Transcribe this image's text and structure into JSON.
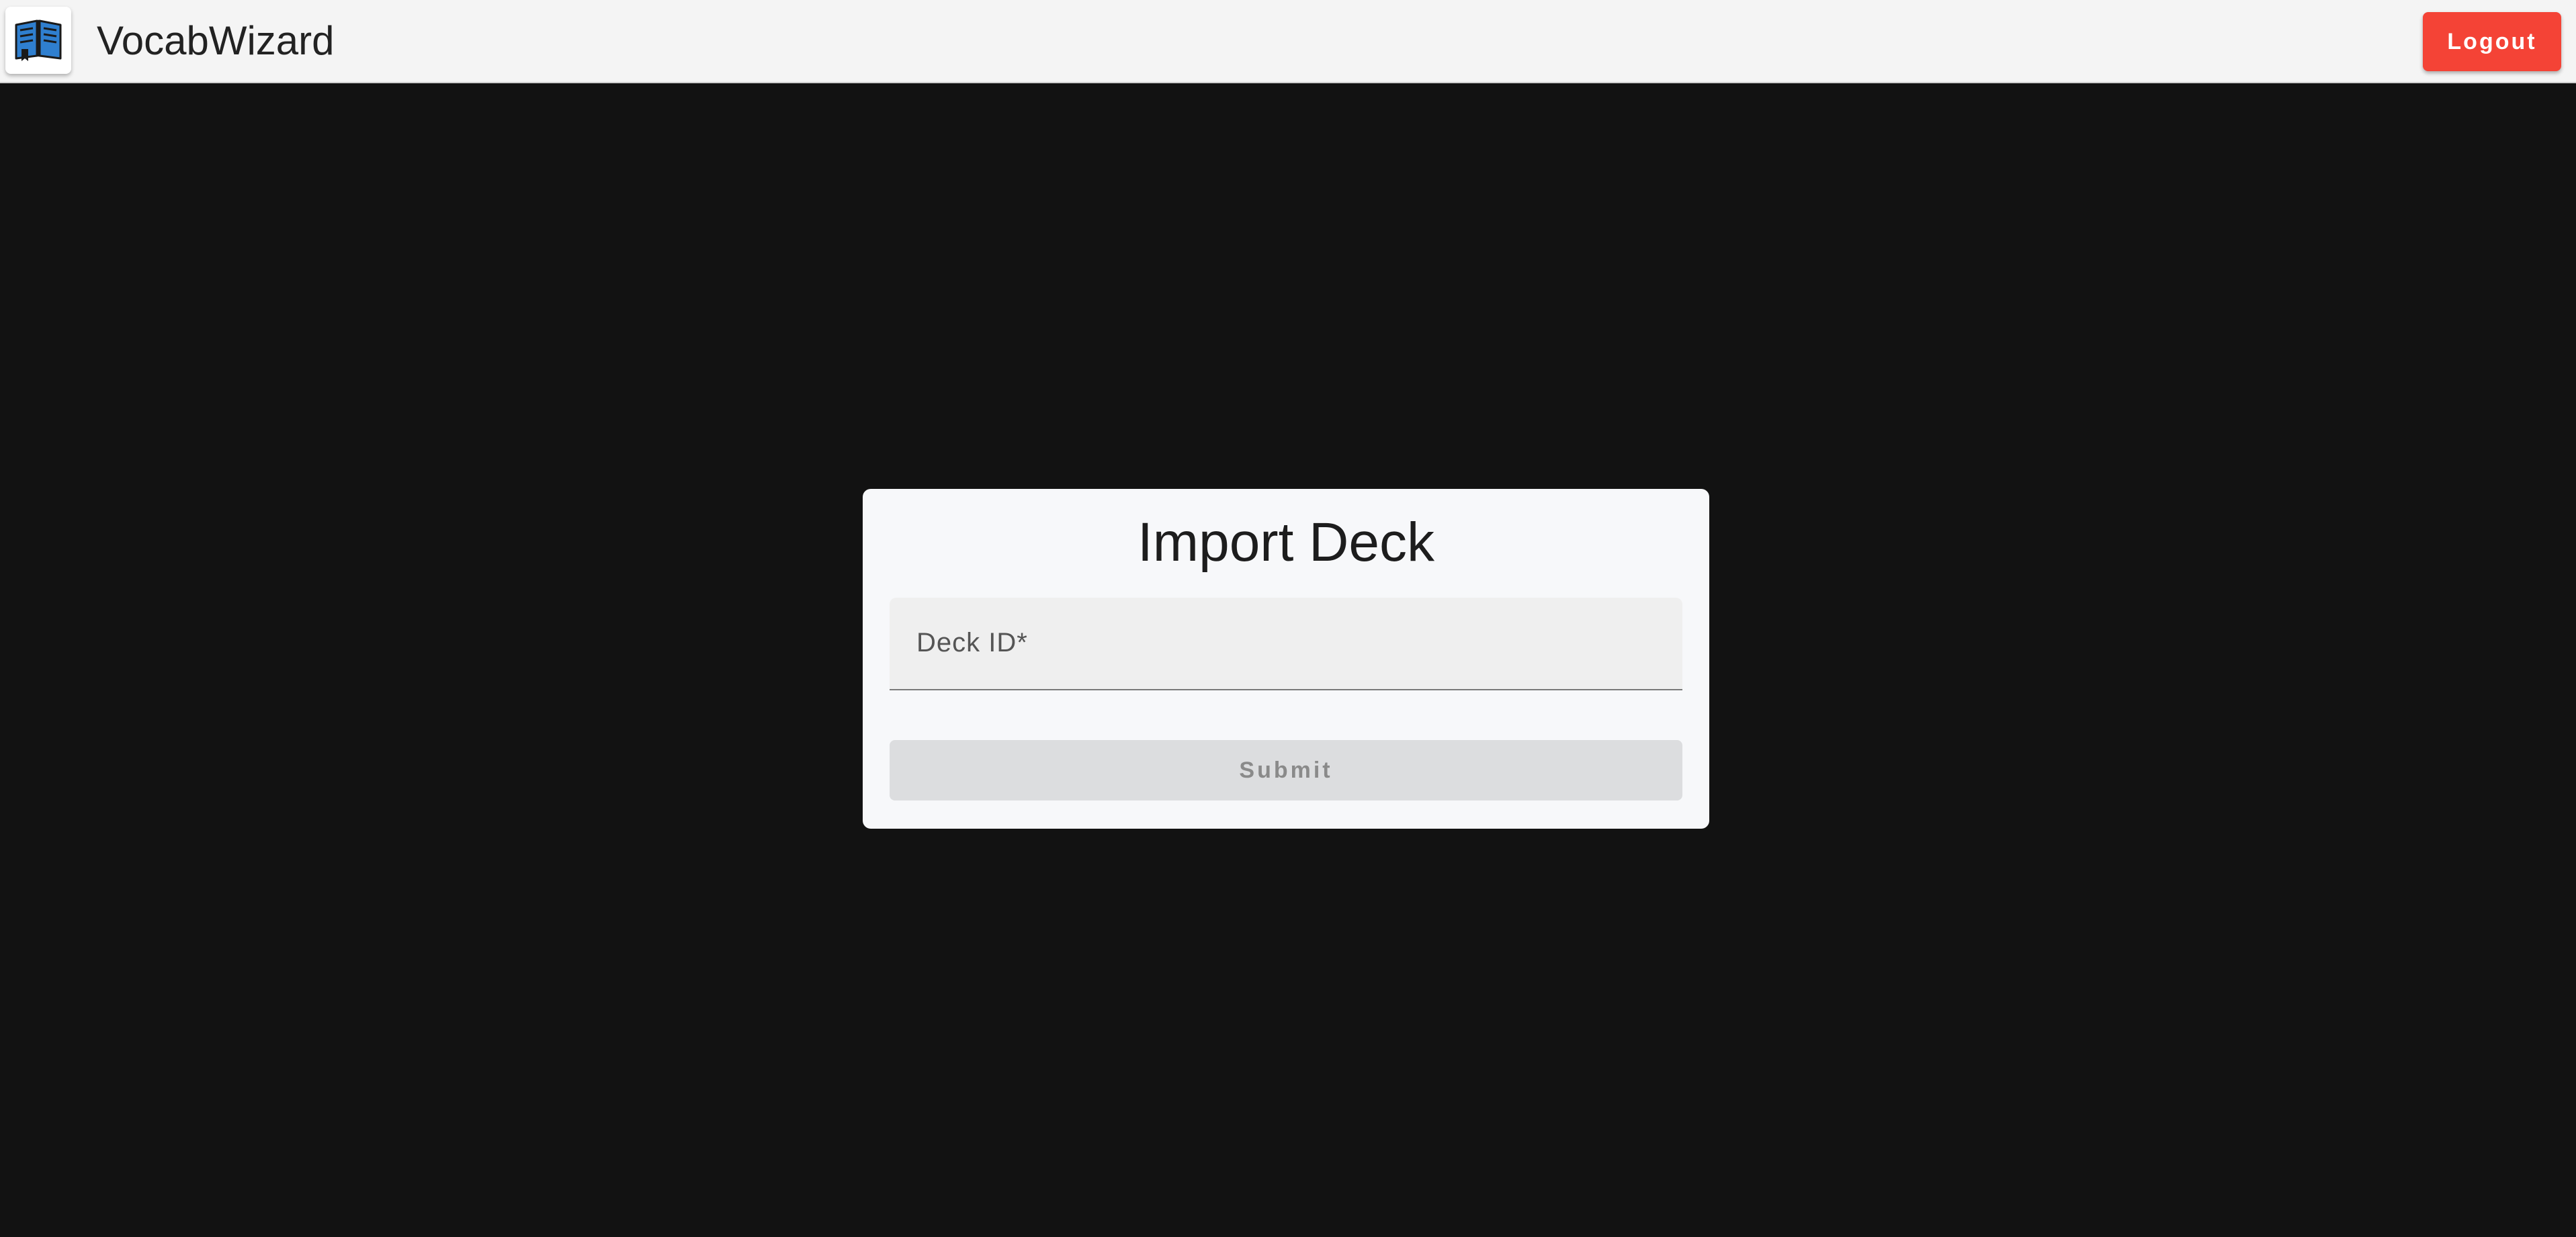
{
  "header": {
    "app_title": "VocabWizard",
    "logo_icon": "open-book-icon",
    "logout_label": "Logout",
    "logout_color": "#f44336"
  },
  "import_card": {
    "title": "Import Deck",
    "deck_id_label": "Deck ID*",
    "deck_id_value": "",
    "submit_label": "Submit",
    "submit_state": "disabled"
  },
  "colors": {
    "background": "#121212",
    "topbar": "#f4f4f4",
    "card": "#f7f8fa",
    "logo_blue": "#2f7fcf"
  }
}
